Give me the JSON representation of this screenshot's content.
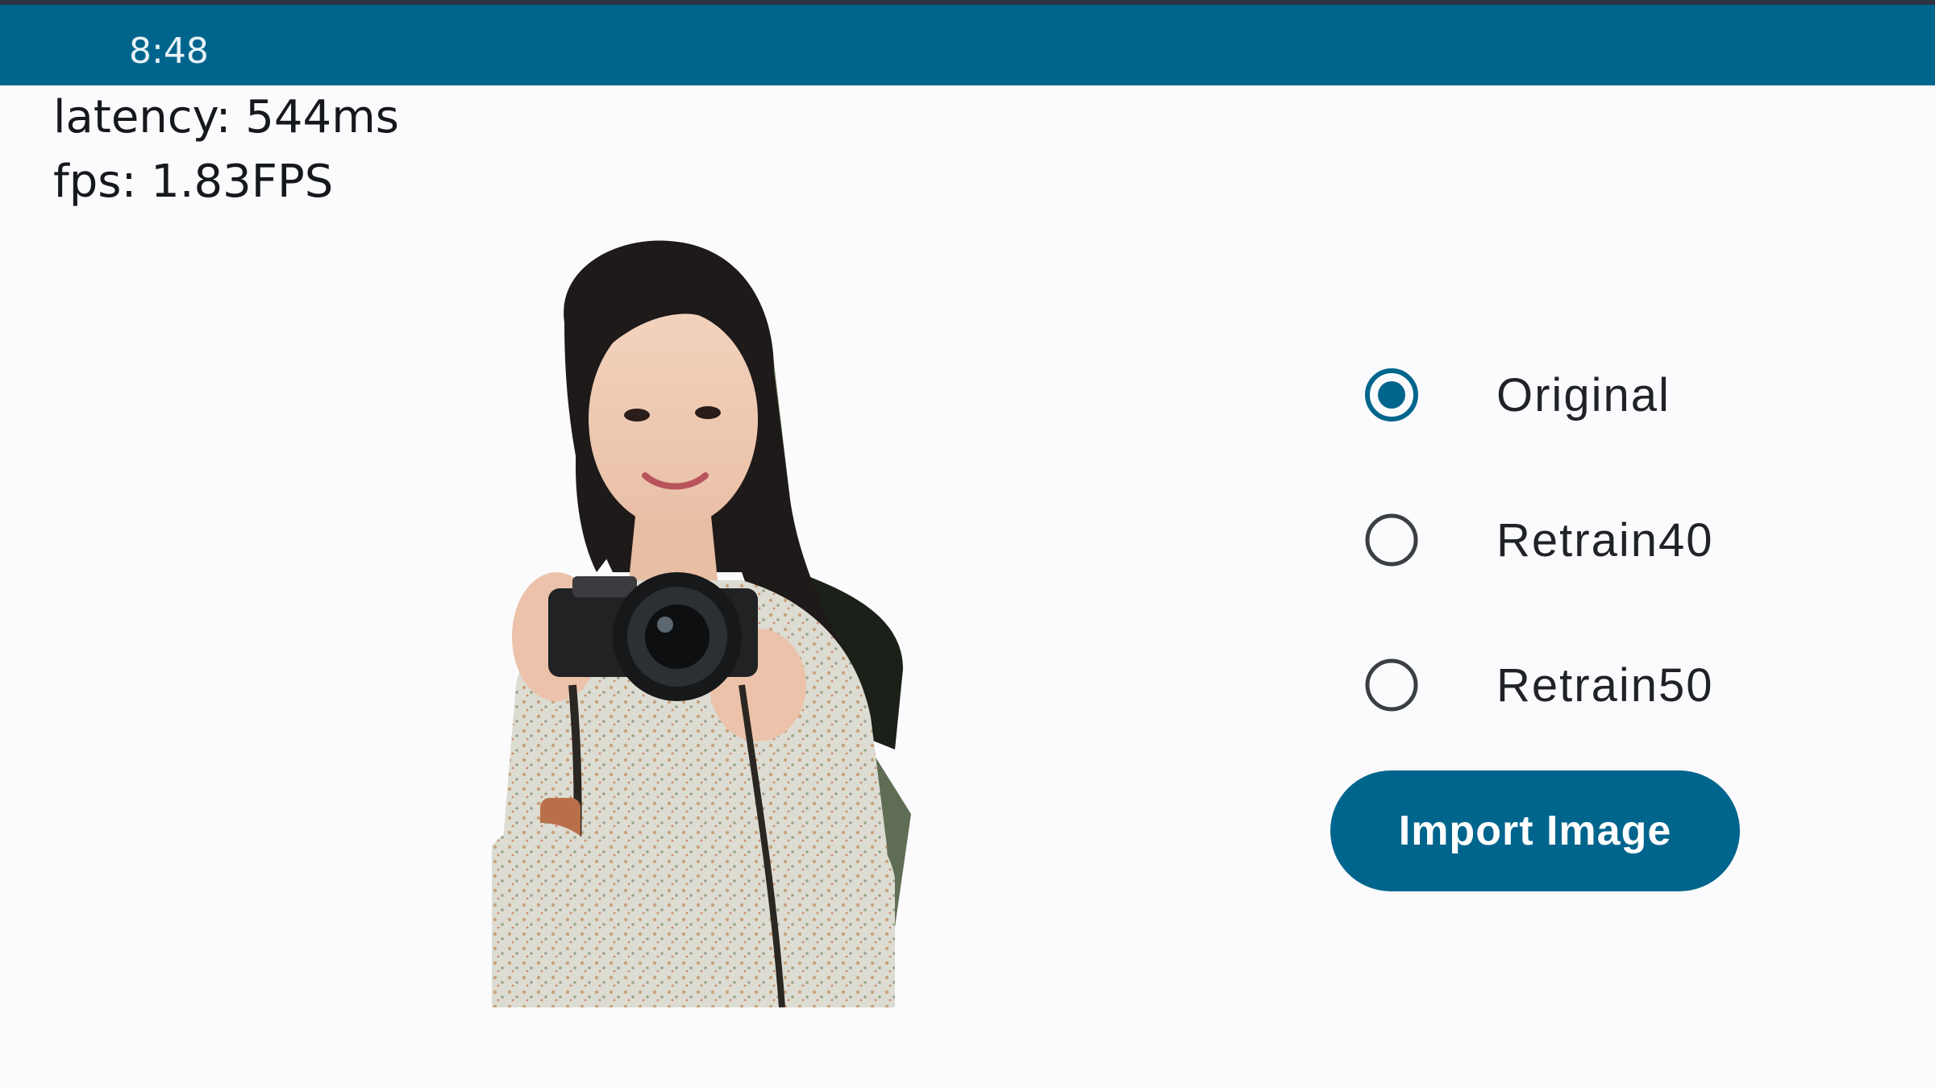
{
  "status_bar": {
    "time": "8:48"
  },
  "metrics": {
    "latency": "latency: 544ms",
    "fps": "fps: 1.83FPS"
  },
  "model_options": [
    {
      "label": "Original",
      "selected": true
    },
    {
      "label": "Retrain40",
      "selected": false
    },
    {
      "label": "Retrain50",
      "selected": false
    }
  ],
  "import_button": {
    "label": "Import Image"
  },
  "colors": {
    "accent": "#00658d",
    "background": "#fbfbfd",
    "text": "#1f2327"
  }
}
